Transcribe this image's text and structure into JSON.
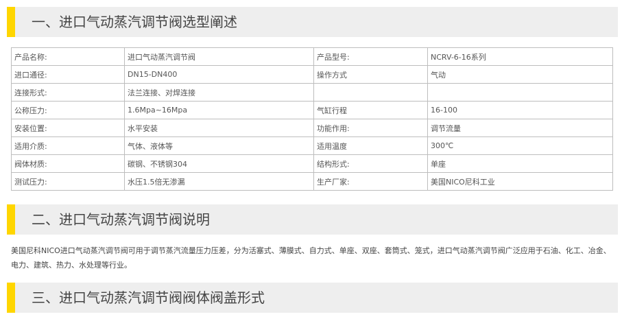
{
  "sections": [
    {
      "title": "一、进口气动蒸汽调节阀选型阐述"
    },
    {
      "title": "二、进口气动蒸汽调节阀说明"
    },
    {
      "title": "三、进口气动蒸汽调节阀阀体阀盖形式"
    }
  ],
  "spec_table": {
    "rows": [
      [
        "产品名称:",
        "进口气动蒸汽调节阀",
        "产品型号:",
        "NCRV-6-16系列"
      ],
      [
        "进口通径:",
        "DN15-DN400",
        "操作方式",
        "气动"
      ],
      [
        "连接形式:",
        "法兰连接、对焊连接",
        "",
        ""
      ],
      [
        "公称压力:",
        "1.6Mpa~16Mpa",
        "气缸行程",
        "16-100"
      ],
      [
        "安装位置:",
        "水平安装",
        "功能作用:",
        "调节流量"
      ],
      [
        "适用介质:",
        "气体、液体等",
        "适用温度",
        "300℃"
      ],
      [
        "阀体材质:",
        "碳钢、不锈钢304",
        "结构形式:",
        "单座"
      ],
      [
        "测试压力:",
        "水压1.5倍无渗漏",
        "生产厂家:",
        "美国NICO尼科工业"
      ]
    ]
  },
  "description": "美国尼科NICO进口气动蒸汽调节阀可用于调节蒸汽流量压力压差，分为活塞式、薄膜式、自力式、单座、双座、套筒式、笼式，进口气动蒸汽调节阀广泛应用于石油、化工、冶金、电力、建筑、热力、水处理等行业。",
  "colors": {
    "accent": "#ffd600",
    "header_bg": "#eeeeee",
    "border": "#bdbdbd"
  }
}
